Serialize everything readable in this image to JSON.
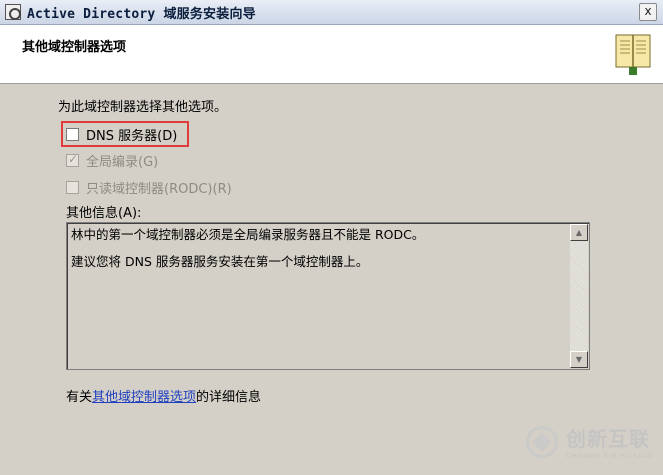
{
  "window": {
    "title": "Active Directory 域服务安装向导",
    "close_label": "x"
  },
  "header": {
    "title": "其他域控制器选项"
  },
  "content": {
    "intro": "为此域控制器选择其他选项。",
    "options": [
      {
        "label": "DNS 服务器(D)",
        "checked": false,
        "enabled": true
      },
      {
        "label": "全局编录(G)",
        "checked": true,
        "enabled": false
      },
      {
        "label": "只读域控制器(RODC)(R)",
        "checked": false,
        "enabled": false
      }
    ],
    "info_label": "其他信息(A):",
    "info_lines": [
      "林中的第一个域控制器必须是全局编录服务器且不能是 RODC。",
      "建议您将 DNS 服务器服务安装在第一个域控制器上。"
    ],
    "footer_prefix": "有关",
    "footer_link": "其他域控制器选项",
    "footer_suffix": "的详细信息"
  },
  "watermark": {
    "name": "创新互联",
    "subtitle": "CHUANG XIN HU LIAN"
  },
  "colors": {
    "highlight": "#e23b3b",
    "link": "#1f3fbf"
  }
}
